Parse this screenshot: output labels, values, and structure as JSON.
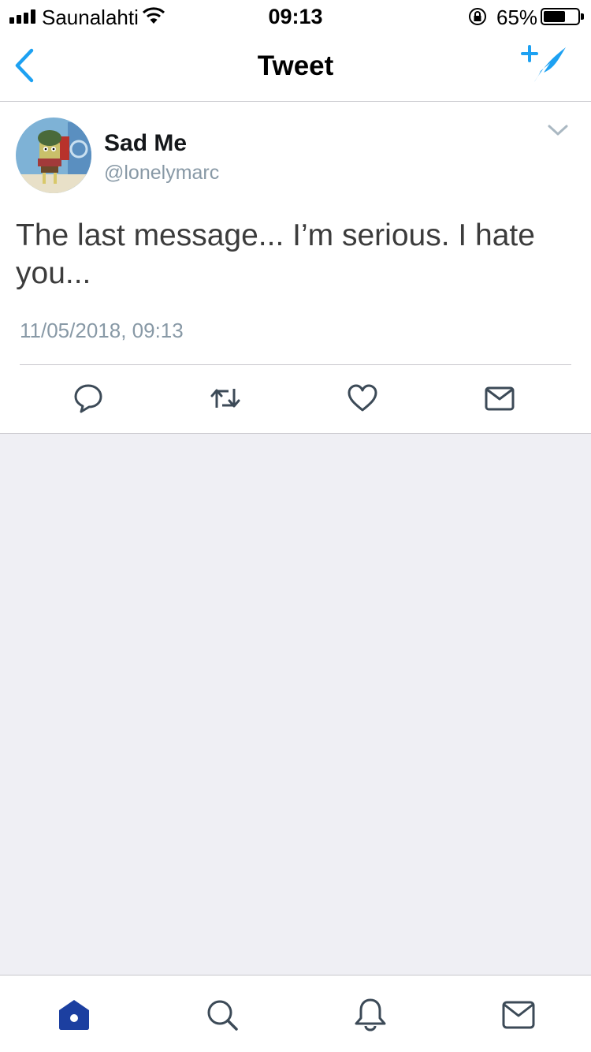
{
  "status_bar": {
    "carrier": "Saunalahti",
    "time": "09:13",
    "battery_percent": "65%",
    "battery_level": 0.65
  },
  "nav": {
    "title": "Tweet",
    "back_icon": "chevron-left-icon",
    "compose_icon": "compose-tweet-icon"
  },
  "tweet": {
    "display_name": "Sad Me",
    "handle": "@lonelymarc",
    "text": "The last message... I’m serious. I hate you...",
    "timestamp": "11/05/2018, 09:13",
    "actions": [
      "reply-icon",
      "retweet-icon",
      "like-icon",
      "direct-message-icon"
    ]
  },
  "tab_bar": {
    "tabs": [
      "home-icon",
      "search-icon",
      "notifications-icon",
      "messages-icon"
    ],
    "active": "home-icon"
  },
  "colors": {
    "accent": "#1da1f2",
    "tab_active": "#1c3fa0",
    "icon_gray": "#3c4a57",
    "secondary_text": "#8899a6",
    "background": "#efeff4"
  }
}
